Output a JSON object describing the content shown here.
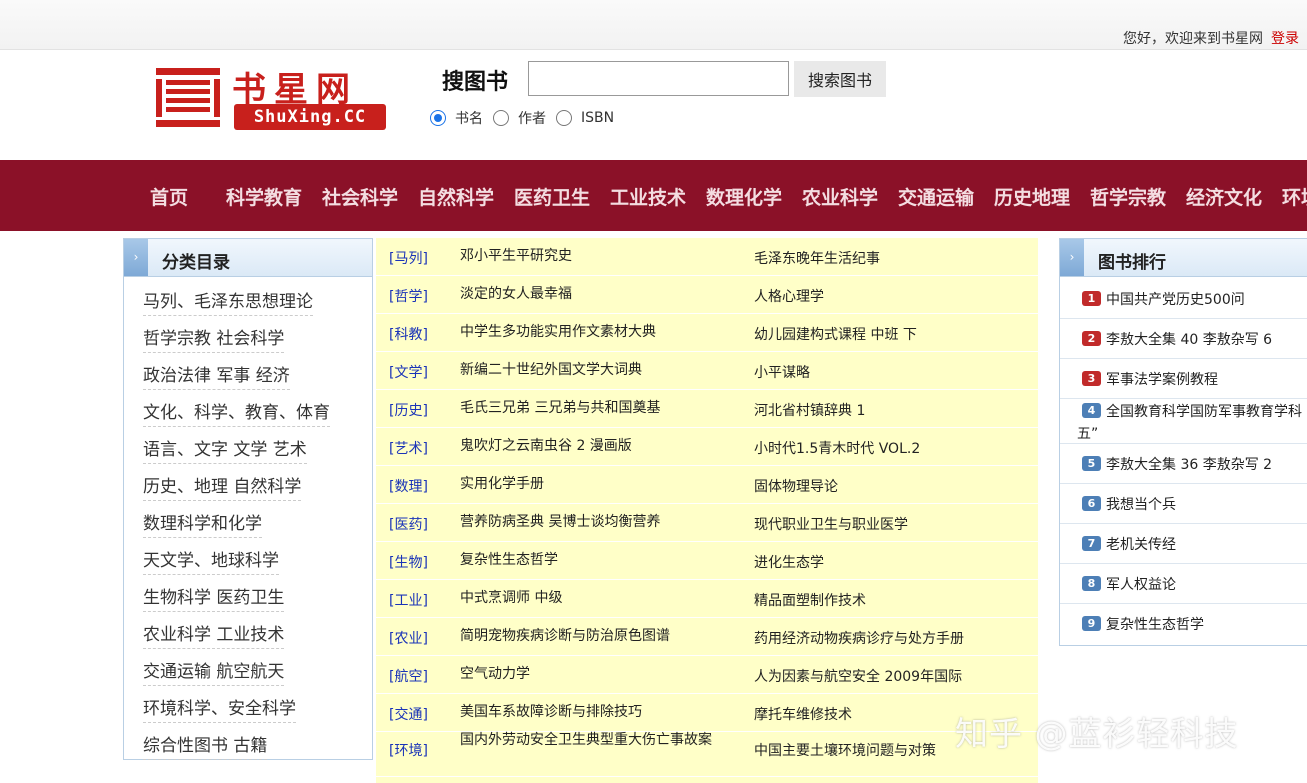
{
  "topbar": {
    "welcome": "您好，欢迎来到书星网",
    "login": "登录"
  },
  "logo": {
    "cn": "书星网",
    "en": "ShuXing.CC"
  },
  "search": {
    "title": "搜图书",
    "value": "",
    "button": "搜索图书",
    "options": [
      "书名",
      "作者",
      "ISBN"
    ],
    "selected": "书名"
  },
  "nav": [
    "首页",
    "科学教育",
    "社会科学",
    "自然科学",
    "医药卫生",
    "工业技术",
    "数理化学",
    "农业科学",
    "交通运输",
    "历史地理",
    "哲学宗教",
    "经济文化",
    "环境"
  ],
  "category": {
    "title": "分类目录",
    "items": [
      "马列、毛泽东思想理论",
      "哲学宗教  社会科学",
      "政治法律   军事    经济",
      "文化、科学、教育、体育",
      "语言、文字  文学  艺术",
      "历史、地理  自然科学",
      "数理科学和化学",
      "天文学、地球科学",
      "生物科学   医药卫生",
      "农业科学   工业技术",
      "交通运输   航空航天",
      "环境科学、安全科学",
      "综合性图书   古籍"
    ]
  },
  "books": [
    {
      "tag": "[马列]",
      "t1": "邓小平生平研究史",
      "t2": "毛泽东晚年生活纪事"
    },
    {
      "tag": "[哲学]",
      "t1": "淡定的女人最幸福",
      "t2": "人格心理学"
    },
    {
      "tag": "[科教]",
      "t1": "中学生多功能实用作文素材大典",
      "t2": "幼儿园建构式课程 中班 下"
    },
    {
      "tag": "[文学]",
      "t1": "新编二十世纪外国文学大词典",
      "t2": "小平谋略"
    },
    {
      "tag": "[历史]",
      "t1": "毛氏三兄弟 三兄弟与共和国奠基",
      "t2": "河北省村镇辞典 1"
    },
    {
      "tag": "[艺术]",
      "t1": "鬼吹灯之云南虫谷 2 漫画版",
      "t2": "小时代1.5青木时代 VOL.2"
    },
    {
      "tag": "[数理]",
      "t1": "实用化学手册",
      "t2": "固体物理导论"
    },
    {
      "tag": "[医药]",
      "t1": "营养防病圣典 吴博士谈均衡营养",
      "t2": "现代职业卫生与职业医学"
    },
    {
      "tag": "[生物]",
      "t1": "复杂性生态哲学",
      "t2": "进化生态学"
    },
    {
      "tag": "[工业]",
      "t1": "中式烹调师 中级",
      "t2": "精品面塑制作技术"
    },
    {
      "tag": "[农业]",
      "t1": "简明宠物疾病诊断与防治原色图谱",
      "t2": "药用经济动物疾病诊疗与处方手册"
    },
    {
      "tag": "[航空]",
      "t1": "空气动力学",
      "t2": "人为因素与航空安全 2009年国际"
    },
    {
      "tag": "[交通]",
      "t1": "美国车系故障诊断与排除技巧",
      "t2": "摩托车维修技术"
    },
    {
      "tag": "[环境]",
      "t1": "国内外劳动安全卫生典型重大伤亡事故案",
      "t2": "中国主要土壤环境问题与对策"
    }
  ],
  "ranking": {
    "title": "图书排行",
    "items": [
      {
        "num": "1",
        "name": "中国共产党历史500问"
      },
      {
        "num": "2",
        "name": "李敖大全集 40 李敖杂写 6"
      },
      {
        "num": "3",
        "name": "军事法学案例教程"
      },
      {
        "num": "4",
        "name": "全国教育科学国防军事教育学科",
        "cont": "五”"
      },
      {
        "num": "5",
        "name": "李敖大全集 36 李敖杂写 2"
      },
      {
        "num": "6",
        "name": "我想当个兵"
      },
      {
        "num": "7",
        "name": "老机关传经"
      },
      {
        "num": "8",
        "name": "军人权益论"
      },
      {
        "num": "9",
        "name": "复杂性生态哲学"
      }
    ]
  },
  "watermark": "知乎 @蓝衫轻科技",
  "colors": {
    "nav_bg": "#8b1128",
    "list_bg": "#ffffc8",
    "logo_red": "#c8201c",
    "tag_blue": "#1a33b8"
  }
}
